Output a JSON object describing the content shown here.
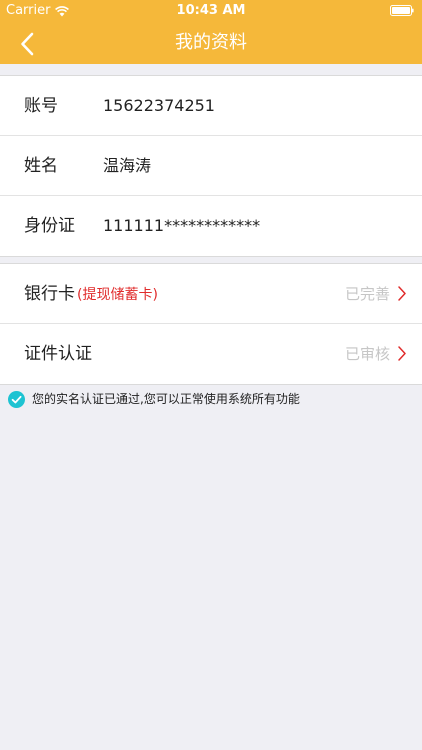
{
  "status_bar": {
    "carrier": "Carrier",
    "time": "10:43 AM"
  },
  "nav": {
    "title": "我的资料"
  },
  "account": {
    "label": "账号",
    "value": "15622374251"
  },
  "name": {
    "label": "姓名",
    "value": "温海涛"
  },
  "id_card": {
    "label": "身份证",
    "value": "111111************"
  },
  "bank_card": {
    "label": "银行卡",
    "hint": "(提现储蓄卡)",
    "status": "已完善"
  },
  "certificate": {
    "label": "证件认证",
    "status": "已审核"
  },
  "notice": {
    "text": "您的实名认证已通过,您可以正常使用系统所有功能"
  },
  "colors": {
    "header": "#f5b83a",
    "accent_red": "#e02b2b",
    "check": "#1ec3d2",
    "background": "#efeff4"
  },
  "icons": {
    "back": "chevron-left-icon",
    "wifi": "wifi-icon",
    "battery": "battery-icon",
    "disclosure": "chevron-right-icon",
    "verified": "check-circle-icon"
  }
}
